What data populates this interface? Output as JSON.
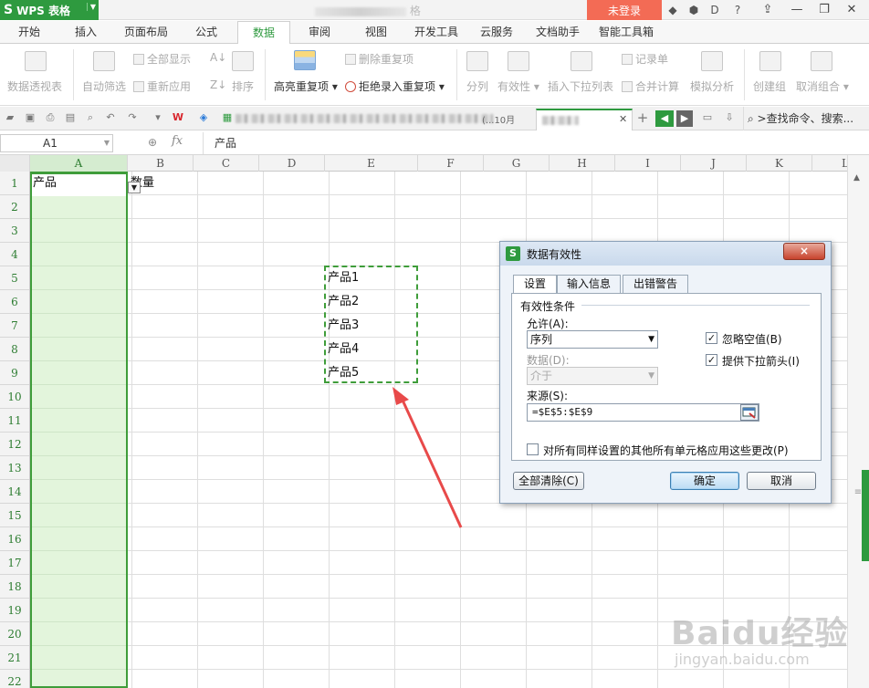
{
  "titlebar": {
    "app_name": "WPS 表格",
    "app_logo": "S",
    "doc_title_suffix": "格",
    "login": "未登录"
  },
  "tabs": [
    "开始",
    "插入",
    "页面布局",
    "公式",
    "数据",
    "审阅",
    "视图",
    "开发工具",
    "云服务",
    "文档助手",
    "智能工具箱"
  ],
  "active_tab": "数据",
  "ribbon": {
    "pivot": "数据透视表",
    "autofilter": "自动筛选",
    "show_all": "全部显示",
    "reapply": "重新应用",
    "sort": "排序",
    "highlight_dup": "高亮重复项",
    "delete_dup": "删除重复项",
    "reject_dup": "拒绝录入重复项",
    "split": "分列",
    "validity": "有效性",
    "insert_dropdown": "插入下拉列表",
    "record_form": "记录单",
    "consolidate": "合并计算",
    "simulate": "模拟分析",
    "group": "创建组",
    "ungroup": "取消组合"
  },
  "qabar": {
    "active_doc_partial": "...10月",
    "search": "查找命令、搜索..."
  },
  "formula_bar": {
    "name_box": "A1",
    "formula": "产品"
  },
  "columns": [
    "A",
    "B",
    "C",
    "D",
    "E",
    "F",
    "G",
    "H",
    "I",
    "J",
    "K",
    "L"
  ],
  "rows": [
    "1",
    "2",
    "3",
    "4",
    "5",
    "6",
    "7",
    "8",
    "9",
    "10",
    "11",
    "12",
    "13",
    "14",
    "15",
    "16",
    "17",
    "18",
    "19",
    "20",
    "21",
    "22"
  ],
  "cells": {
    "A1": "产品",
    "B1": "数量",
    "E5": "产品1",
    "E6": "产品2",
    "E7": "产品3",
    "E8": "产品4",
    "E9": "产品5"
  },
  "dialog": {
    "title": "数据有效性",
    "close": "×",
    "tabs": [
      "设置",
      "输入信息",
      "出错警告"
    ],
    "group_title": "有效性条件",
    "allow_label": "允许(A):",
    "allow_value": "序列",
    "data_label": "数据(D):",
    "data_value": "介于",
    "ignore_blank": "忽略空值(B)",
    "ignore_blank_checked": true,
    "dropdown_arrow": "提供下拉箭头(I)",
    "dropdown_arrow_checked": true,
    "source_label": "来源(S):",
    "source_value": "=$E$5:$E$9",
    "apply_all": "对所有同样设置的其他所有单元格应用这些更改(P)",
    "apply_all_checked": false,
    "clear_all": "全部清除(C)",
    "ok": "确定",
    "cancel": "取消"
  },
  "watermark": {
    "line1": "Baidu经验",
    "line2": "jingyan.baidu.com"
  },
  "colors": {
    "accent": "#2e9a3f",
    "login": "#f36b55",
    "arrow": "#e84a4a",
    "selection_fill": "#e3f5dc"
  }
}
